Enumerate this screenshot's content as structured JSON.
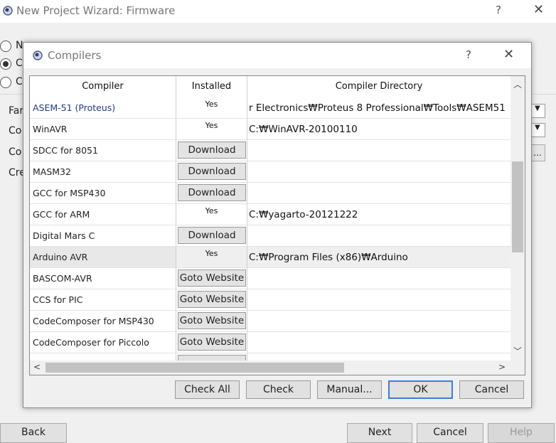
{
  "wizard": {
    "title": "New Project Wizard: Firmware",
    "help": "?",
    "close": "✕",
    "radios": [
      {
        "label": "N",
        "selected": false
      },
      {
        "label": "C",
        "selected": true
      },
      {
        "label": "C",
        "selected": false
      }
    ],
    "labels": [
      "Far",
      "Co",
      "Co",
      "Cre"
    ],
    "browse": "...",
    "buttons": {
      "back": "Back",
      "next": "Next",
      "cancel": "Cancel",
      "help": "Help"
    }
  },
  "dialog": {
    "title": "Compilers",
    "help": "?",
    "close": "✕",
    "columns": [
      "Compiler",
      "Installed",
      "Compiler Directory"
    ],
    "rows": [
      {
        "name": "ASEM-51 (Proteus)",
        "installed": "Yes",
        "directory": "r Electronics₩Proteus 8 Professional₩Tools₩ASEM51"
      },
      {
        "name": "WinAVR",
        "installed": "Yes",
        "directory": "C:₩WinAVR-20100110"
      },
      {
        "name": "SDCC for 8051",
        "action": "Download",
        "directory": ""
      },
      {
        "name": "MASM32",
        "action": "Download",
        "directory": ""
      },
      {
        "name": "GCC for MSP430",
        "action": "Download",
        "directory": ""
      },
      {
        "name": "GCC for ARM",
        "installed": "Yes",
        "directory": "C:₩yagarto-20121222"
      },
      {
        "name": "Digital Mars C",
        "action": "Download",
        "directory": ""
      },
      {
        "name": "Arduino AVR",
        "installed": "Yes",
        "directory": "C:₩Program Files (x86)₩Arduino"
      },
      {
        "name": "BASCOM-AVR",
        "action": "Goto Website",
        "directory": ""
      },
      {
        "name": "CCS for PIC",
        "action": "Goto Website",
        "directory": ""
      },
      {
        "name": "CodeComposer for MSP430",
        "action": "Goto Website",
        "directory": ""
      },
      {
        "name": "CodeComposer for Piccolo",
        "action": "Goto Website",
        "directory": ""
      },
      {
        "name": "",
        "action": " ",
        "directory": ""
      }
    ],
    "buttons": {
      "check_all": "Check All",
      "check": "Check",
      "manual": "Manual...",
      "ok": "OK",
      "cancel": "Cancel"
    }
  },
  "scroll_icons": {
    "up": "up-arrow-icon",
    "down": "down-arrow-icon",
    "left": "left-arrow-icon",
    "right": "right-arrow-icon"
  }
}
